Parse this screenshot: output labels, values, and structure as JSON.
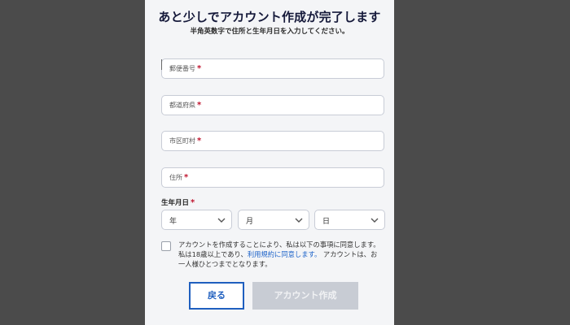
{
  "header": {
    "title": "あと少しでアカウント作成が完了します",
    "subtitle": "半角英数字で住所と生年月日を入力してください。"
  },
  "fields": {
    "postal_code": {
      "placeholder": "郵便番号"
    },
    "prefecture": {
      "placeholder": "都道府県"
    },
    "city": {
      "placeholder": "市区町村"
    },
    "address": {
      "placeholder": "住所"
    }
  },
  "required_mark": "*",
  "birthdate": {
    "label": "生年月日",
    "year": "年",
    "month": "月",
    "day": "日"
  },
  "consent": {
    "text_before": "アカウントを作成することにより、私は以下の事項に同意します。私は18歳以上であり、",
    "link": "利用規約に同意します。",
    "text_after": " アカウントは、お一人様ひとつまでとなります。",
    "checked": false
  },
  "buttons": {
    "back": "戻る",
    "create": "アカウント作成"
  },
  "colors": {
    "accent": "#1f5fbf",
    "required": "#c0152f",
    "disabled_button": "#c8ccd4",
    "link": "#1d63c9"
  },
  "icons": {
    "select_arrow": "chevron-down-icon"
  }
}
